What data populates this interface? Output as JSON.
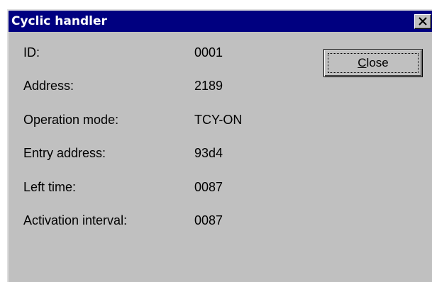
{
  "window": {
    "title": "Cyclic handler"
  },
  "fields": [
    {
      "label": "ID:",
      "value": "0001"
    },
    {
      "label": "Address:",
      "value": "2189"
    },
    {
      "label": "Operation mode:",
      "value": "TCY-ON"
    },
    {
      "label": "Entry address:",
      "value": "93d4"
    },
    {
      "label": "Left time:",
      "value": "0087"
    },
    {
      "label": "Activation interval:",
      "value": "0087"
    }
  ],
  "buttons": {
    "close_mnemonic": "C",
    "close_rest": "lose"
  },
  "icons": {
    "title_close": "close-icon"
  },
  "colors": {
    "titlebar": "#000080",
    "window_bg": "#c0c0c0",
    "title_text": "#ffffff"
  }
}
